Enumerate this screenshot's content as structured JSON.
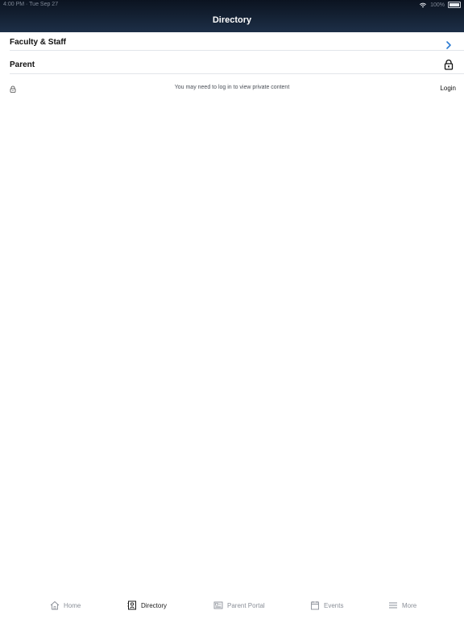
{
  "status_bar": {
    "time_date": "4:00 PM · Tue Sep 27",
    "battery": "100%"
  },
  "nav": {
    "title": "Directory"
  },
  "sections": [
    {
      "label": "Faculty & Staff"
    },
    {
      "label": "Parent"
    }
  ],
  "notice": {
    "message": "You may need to log in to view private content",
    "login_label": "Login"
  },
  "tabbar": {
    "items": [
      {
        "label": "Home"
      },
      {
        "label": "Directory"
      },
      {
        "label": "Parent Portal"
      },
      {
        "label": "Events"
      },
      {
        "label": "More"
      }
    ],
    "active": "Directory"
  },
  "colors": {
    "header_top": "#0b1320",
    "header_bottom": "#1d2f47",
    "chevron": "#2a7ad1"
  },
  "icons": {
    "faculty": "chevron-right-icon",
    "parent": "lock-icon",
    "home": "home-icon",
    "directory": "directory-icon",
    "parent_portal": "newspaper-icon",
    "events": "calendar-icon",
    "more": "menu-icon"
  }
}
